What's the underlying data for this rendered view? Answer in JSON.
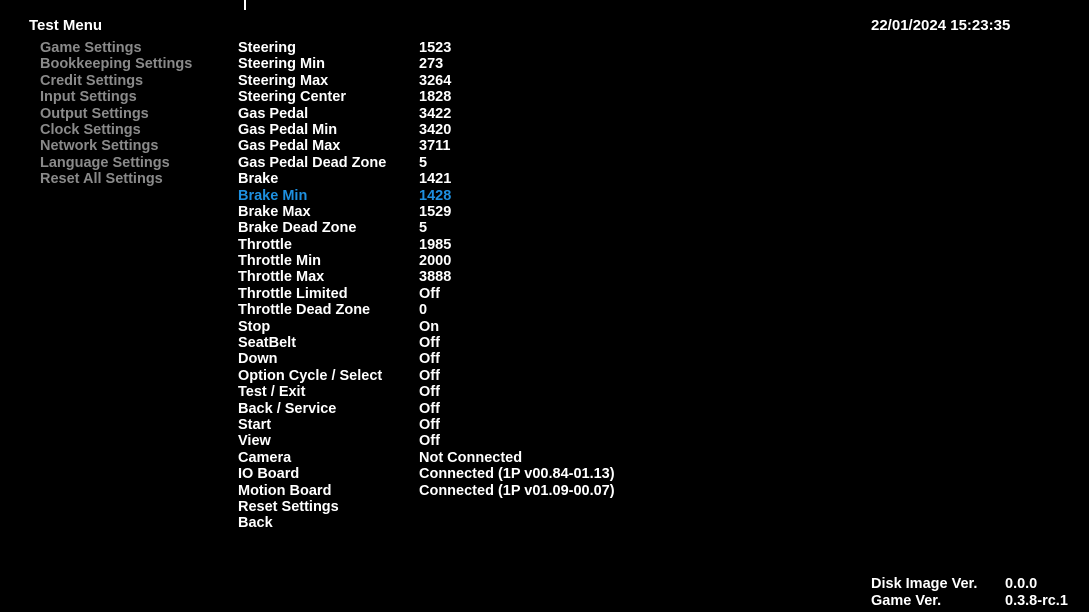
{
  "header": {
    "title": "Test Menu",
    "datetime": "22/01/2024 15:23:35"
  },
  "menu": {
    "items": [
      "Game Settings",
      "Bookkeeping Settings",
      "Credit Settings",
      "Input Settings",
      "Output Settings",
      "Clock Settings",
      "Network Settings",
      "Language Settings",
      "Reset All Settings"
    ]
  },
  "input_settings": {
    "selected_index": 9,
    "rows": [
      {
        "label": "Steering",
        "value": "1523"
      },
      {
        "label": "Steering Min",
        "value": "273"
      },
      {
        "label": "Steering Max",
        "value": "3264"
      },
      {
        "label": "Steering Center",
        "value": "1828"
      },
      {
        "label": "Gas Pedal",
        "value": "3422"
      },
      {
        "label": "Gas Pedal Min",
        "value": "3420"
      },
      {
        "label": "Gas Pedal Max",
        "value": "3711"
      },
      {
        "label": "Gas Pedal Dead Zone",
        "value": "5"
      },
      {
        "label": "Brake",
        "value": "1421"
      },
      {
        "label": "Brake Min",
        "value": "1428"
      },
      {
        "label": "Brake Max",
        "value": "1529"
      },
      {
        "label": "Brake Dead Zone",
        "value": "5"
      },
      {
        "label": "Throttle",
        "value": "1985"
      },
      {
        "label": "Throttle Min",
        "value": "2000"
      },
      {
        "label": "Throttle Max",
        "value": "3888"
      },
      {
        "label": "Throttle Limited",
        "value": "Off"
      },
      {
        "label": "Throttle Dead Zone",
        "value": "0"
      },
      {
        "label": "Stop",
        "value": "On"
      },
      {
        "label": "SeatBelt",
        "value": "Off"
      },
      {
        "label": "Down",
        "value": "Off"
      },
      {
        "label": "Option Cycle / Select",
        "value": "Off"
      },
      {
        "label": "Test / Exit",
        "value": "Off"
      },
      {
        "label": "Back / Service",
        "value": "Off"
      },
      {
        "label": "Start",
        "value": "Off"
      },
      {
        "label": "View",
        "value": "Off"
      },
      {
        "label": "Camera",
        "value": "Not Connected"
      },
      {
        "label": "IO Board",
        "value": "Connected (1P v00.84-01.13)"
      },
      {
        "label": "Motion Board",
        "value": "Connected (1P v01.09-00.07)"
      },
      {
        "label": "Reset Settings",
        "value": ""
      },
      {
        "label": "Back",
        "value": ""
      }
    ]
  },
  "footer": {
    "disk_image_label": "Disk Image Ver.",
    "disk_image_value": "0.0.0",
    "game_label": "Game Ver.",
    "game_value": "0.3.8-rc.1"
  },
  "colors": {
    "background": "#000000",
    "text": "#ffffff",
    "menu_text": "#8a8a8a",
    "selected": "#1e90e0"
  }
}
